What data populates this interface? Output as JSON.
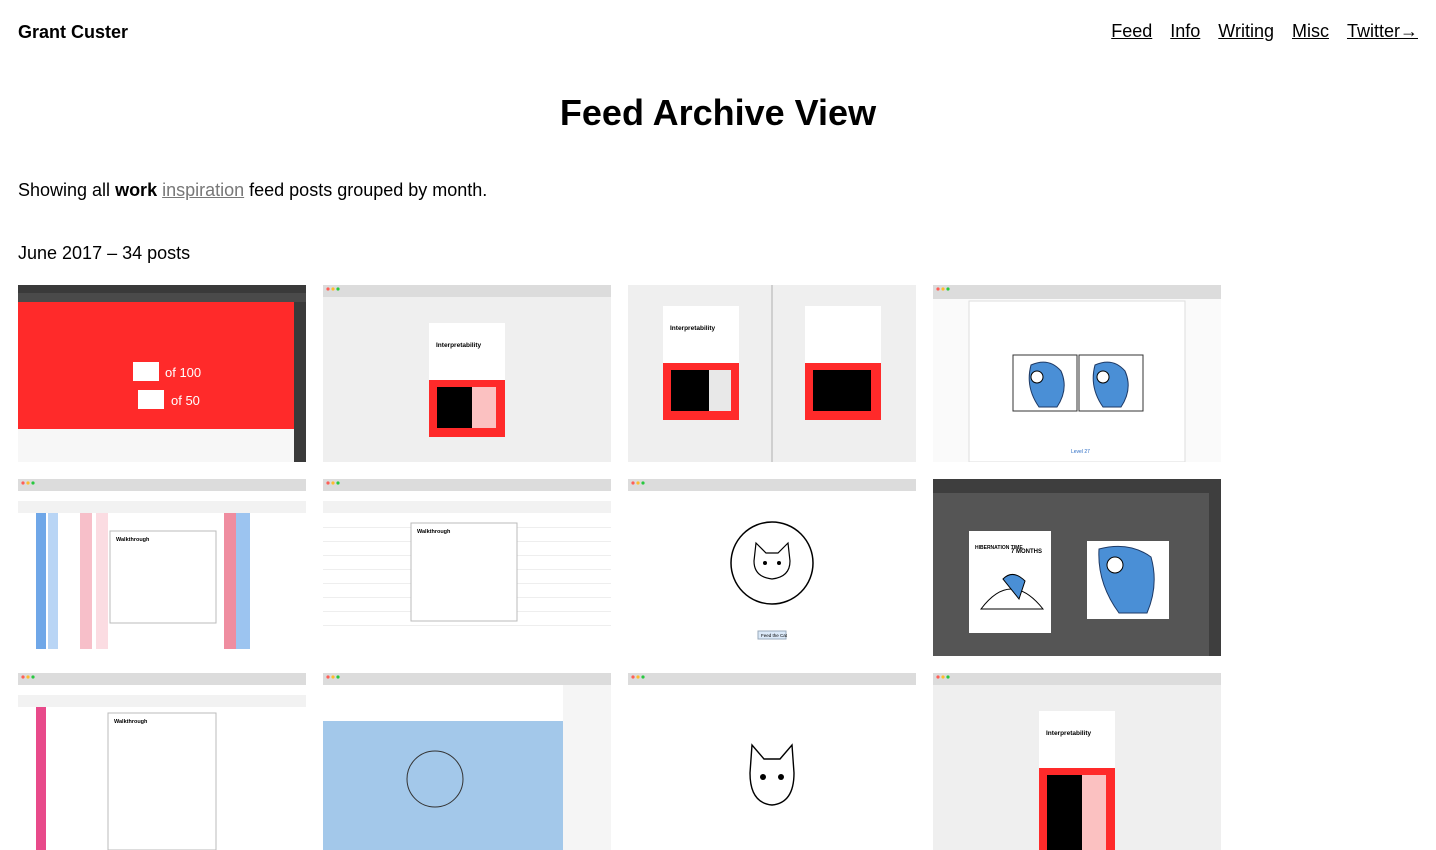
{
  "header": {
    "site_title": "Grant Custer",
    "nav": [
      "Feed",
      "Info",
      "Writing",
      "Misc",
      "Twitter→"
    ]
  },
  "page": {
    "title": "Feed Archive View",
    "intro": {
      "prefix": "Showing all ",
      "strong": "work",
      "link": "inspiration",
      "suffix": " feed posts grouped by month."
    }
  },
  "month_group": {
    "heading": "June 2017 – 34 posts"
  },
  "thumbnails": {
    "t1": {
      "line1": "of 100",
      "line2": "of 50"
    },
    "t2": {
      "title": "Interpretability"
    },
    "t3": {
      "title": "Interpretability"
    },
    "t4": {
      "label": "Level 27"
    },
    "t5": {
      "heading": "Walkthrough"
    },
    "t6": {
      "heading": "Walkthrough"
    },
    "t7": {
      "button": "Feed the Cat"
    },
    "t8": {
      "heading": "HIBERNATION TIME",
      "months": "7 MONTHS"
    },
    "t9": {
      "heading": "Walkthrough"
    },
    "t12": {
      "title": "Interpretability"
    }
  },
  "colors": {
    "accent_red": "#ff2a2a",
    "link_gray": "#777777",
    "blob_blue": "#4a8fd6",
    "sky_blue": "#a3c8ea",
    "dark_gray": "#555555"
  }
}
